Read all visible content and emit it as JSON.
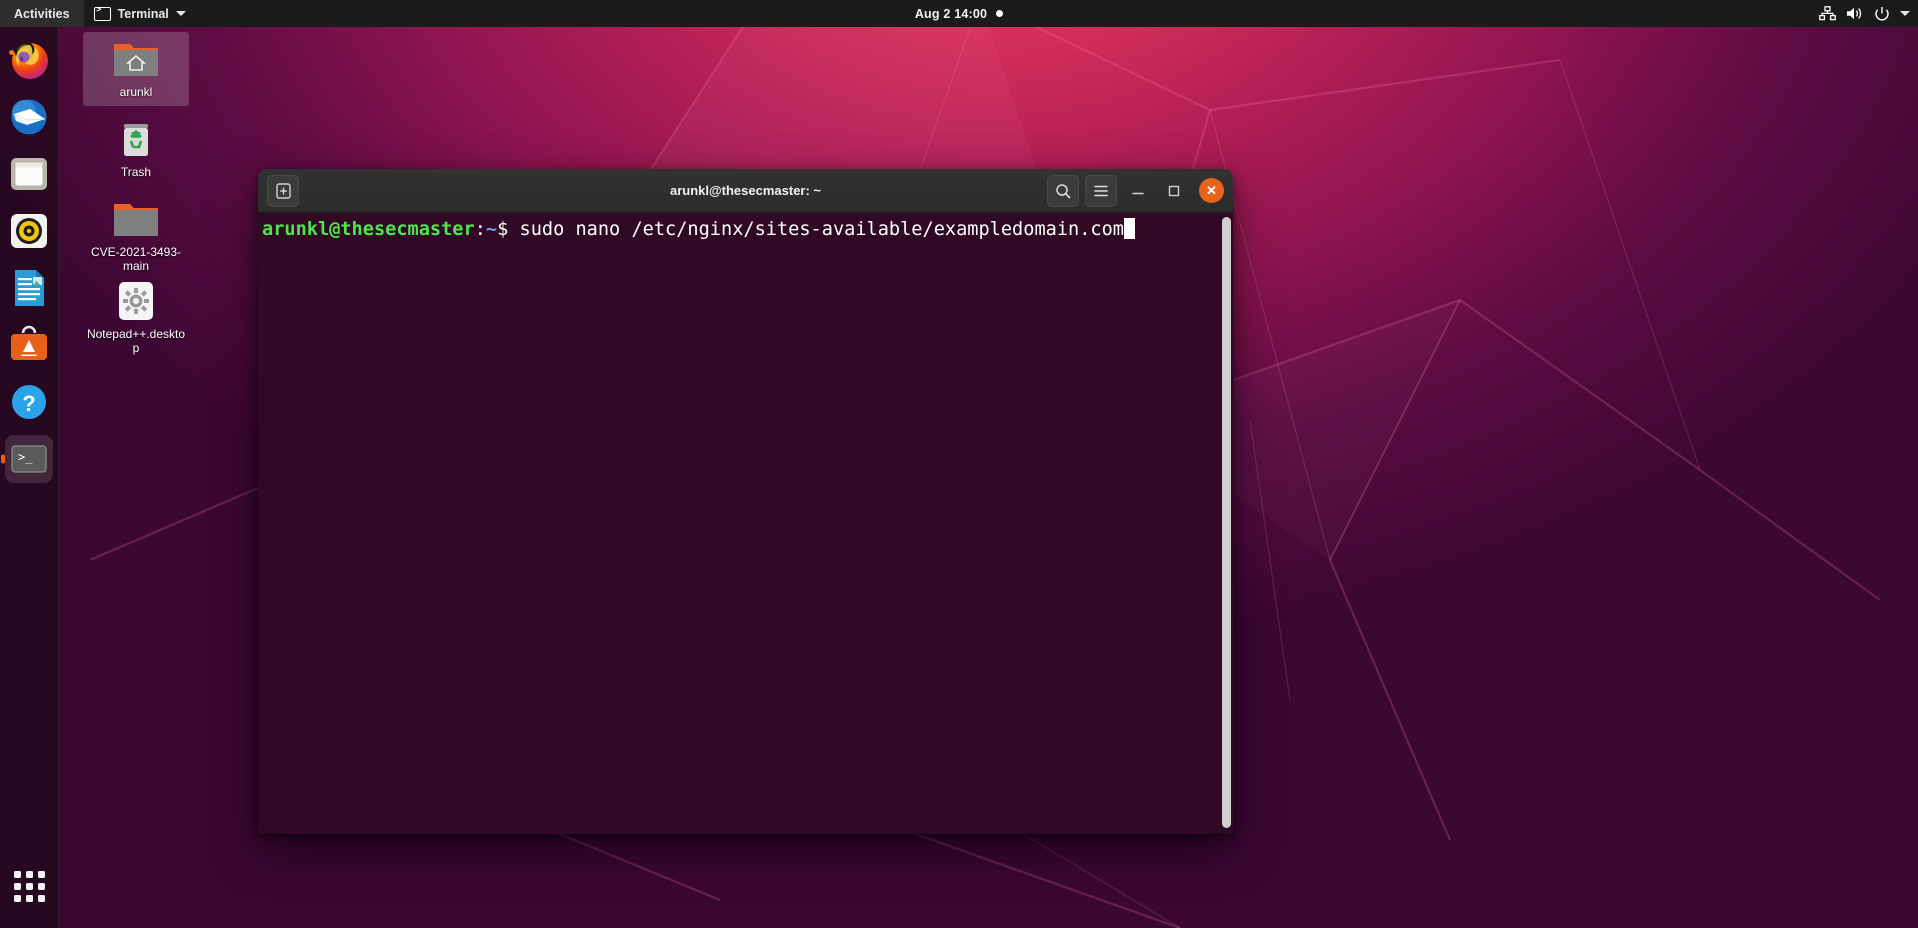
{
  "topbar": {
    "activities_label": "Activities",
    "app_menu": {
      "label": "Terminal",
      "icon": "terminal-icon",
      "chevron": "▾"
    },
    "clock": "Aug 2  14:00",
    "notification_dot": "●",
    "tray": [
      {
        "name": "network-icon"
      },
      {
        "name": "volume-icon"
      },
      {
        "name": "power-icon"
      },
      {
        "name": "chevron-down-icon"
      }
    ]
  },
  "dock": {
    "items": [
      {
        "name": "firefox",
        "label": "Firefox",
        "running": false,
        "active": false
      },
      {
        "name": "thunderbird",
        "label": "Thunderbird Mail",
        "running": false,
        "active": false
      },
      {
        "name": "files",
        "label": "Files",
        "running": false,
        "active": false
      },
      {
        "name": "rhythmbox",
        "label": "Rhythmbox",
        "running": false,
        "active": false
      },
      {
        "name": "libreoffice-writer",
        "label": "LibreOffice Writer",
        "running": false,
        "active": false
      },
      {
        "name": "ubuntu-software",
        "label": "Ubuntu Software",
        "running": false,
        "active": false
      },
      {
        "name": "help",
        "label": "Help",
        "running": false,
        "active": false
      },
      {
        "name": "terminal",
        "label": "Terminal",
        "running": true,
        "active": true
      }
    ],
    "show_applications_label": "Show Applications"
  },
  "desktop_icons": [
    {
      "label": "arunkl",
      "icon": "home-folder-icon",
      "selected": true
    },
    {
      "label": "Trash",
      "icon": "trash-icon",
      "selected": false
    },
    {
      "label": "CVE-2021-3493-main",
      "icon": "folder-icon",
      "selected": false
    },
    {
      "label": "Notepad++.desktop",
      "icon": "gear-executable-icon",
      "selected": false
    }
  ],
  "terminal": {
    "title": "arunkl@thesecmaster: ~",
    "buttons": {
      "new_tab": "new-tab",
      "search": "search",
      "menu": "menu",
      "minimize": "–",
      "maximize": "❐",
      "close": "✕"
    },
    "prompt": {
      "user_host": "arunkl@thesecmaster",
      "colon": ":",
      "path": "~",
      "dollar": "$ "
    },
    "command": "sudo nano /etc/nginx/sites-available/exampledomain.com",
    "cursor_visible": true
  },
  "colors": {
    "terminal_bg": "#300a24",
    "titlebar_bg": "#2c2c2c",
    "close_button": "#e8641c",
    "prompt_green": "#4ee44e",
    "prompt_blue": "#6a9ef5",
    "topbar_bg": "#1b1b1b",
    "accent_orange": "#e8601c"
  }
}
